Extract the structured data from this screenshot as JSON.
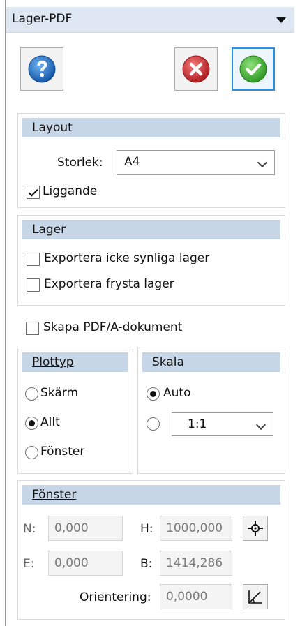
{
  "panel": {
    "title": "Lager-PDF",
    "title_menu_icon": "chevron-down-icon"
  },
  "toolbar": {
    "help_icon": "help-icon",
    "cancel_icon": "cancel-icon",
    "ok_icon": "ok-check-icon"
  },
  "layout": {
    "header": "Layout",
    "size_label": "Storlek:",
    "size_value": "A4",
    "landscape_label": "Liggande",
    "landscape_checked": true
  },
  "lager": {
    "header": "Lager",
    "export_hidden_label": "Exportera icke synliga lager",
    "export_hidden_checked": false,
    "export_frozen_label": "Exportera frysta lager",
    "export_frozen_checked": false
  },
  "pdfa": {
    "label": "Skapa PDF/A-dokument",
    "checked": false
  },
  "plottyp": {
    "header": "Plottyp",
    "options": [
      "Skärm",
      "Allt",
      "Fönster"
    ],
    "selected": "Allt"
  },
  "skala": {
    "header": "Skala",
    "auto_label": "Auto",
    "selected": "Auto",
    "scale_value": "1:1"
  },
  "fonster": {
    "header": "Fönster",
    "n_label": "N:",
    "n_value": "0,000",
    "e_label": "E:",
    "e_value": "0,000",
    "h_label": "H:",
    "h_value": "1000,000",
    "b_label": "B:",
    "b_value": "1414,286",
    "orientation_label": "Orientering:",
    "orientation_value": "0,0000",
    "pick_window_icon": "crosshair-icon",
    "pick_angle_icon": "angle-icon"
  },
  "colors": {
    "title_bg": "#dfe8f2",
    "group_header_bg": "#c7d6e6",
    "accent_border": "#2b8fe0",
    "help_blue": "#1f6fc4",
    "cancel_red": "#d9383a",
    "ok_green": "#4fba3d"
  }
}
